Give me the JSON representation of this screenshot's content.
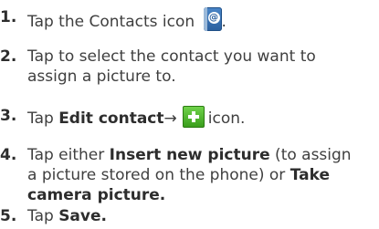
{
  "steps": [
    {
      "number": "1.",
      "text_before": "Tap the Contacts icon ",
      "text_after": ".",
      "icon": "contacts-icon"
    },
    {
      "number": "2.",
      "line1": "Tap to select the contact you want to",
      "line2": "assign a picture to."
    },
    {
      "number": "3.",
      "text_before": "Tap ",
      "bold": "Edit contact",
      "arrow": "→",
      "icon": "plus-icon",
      "text_after": "icon."
    },
    {
      "number": "4.",
      "line1_before": "Tap either ",
      "line1_bold": "Insert new picture",
      "line1_after": " (to assign",
      "line2_before": "a picture stored on the phone) or ",
      "line2_bold": "Take",
      "line3_bold": "camera picture."
    },
    {
      "number": "5.",
      "text_before": "Tap ",
      "bold": "Save."
    }
  ]
}
